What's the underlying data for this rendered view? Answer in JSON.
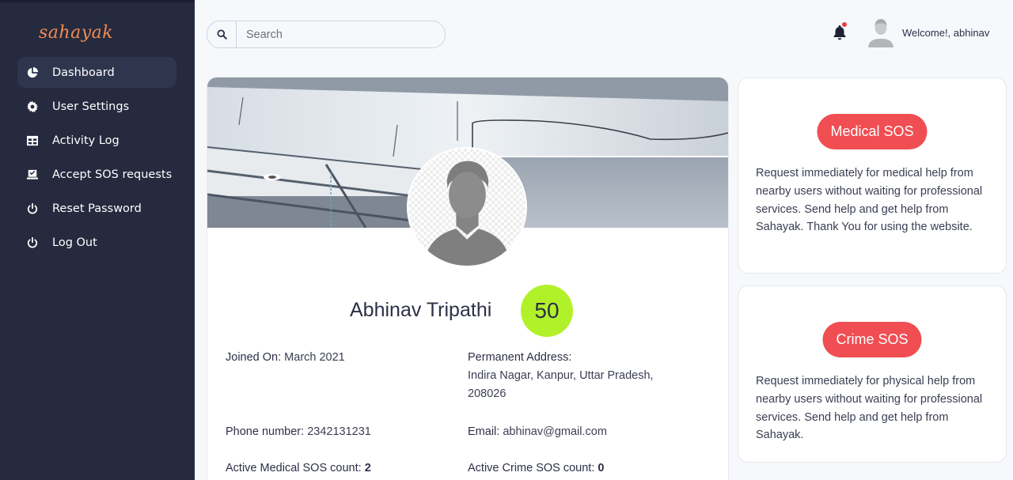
{
  "brand": "sahayak",
  "sidebar": {
    "items": [
      {
        "label": "Dashboard",
        "icon": "pie-chart-icon",
        "active": true
      },
      {
        "label": "User Settings",
        "icon": "gear-icon"
      },
      {
        "label": "Activity Log",
        "icon": "table-icon"
      },
      {
        "label": "Accept SOS requests",
        "icon": "laptop-check-icon"
      },
      {
        "label": "Reset Password",
        "icon": "power-icon"
      },
      {
        "label": "Log Out",
        "icon": "power-icon"
      }
    ]
  },
  "header": {
    "search_placeholder": "Search",
    "welcome": "Welcome!, abhinav",
    "notification_dot_color": "#ef3b45"
  },
  "profile": {
    "name": "Abhinav Tripathi",
    "score": "50",
    "joined_label": "Joined On:",
    "joined_value": "March 2021",
    "address_label": "Permanent Address:",
    "address_line1": "Indira Nagar, Kanpur, Uttar Pradesh,",
    "address_line2": "208026",
    "phone_label": "Phone number:",
    "phone_value": "2342131231",
    "email_label": "Email:",
    "email_value": "abhinav@gmail.com",
    "medical_count_label": "Active Medical SOS count:",
    "medical_count_value": "2",
    "crime_count_label": "Active Crime SOS count:",
    "crime_count_value": "0"
  },
  "medical_sos": {
    "button": "Medical SOS",
    "description": "Request immediately for medical help from nearby users without waiting for professional services. Send help and get help from Sahayak. Thank You for using the website."
  },
  "crime_sos": {
    "button": "Crime SOS",
    "description": "Request immediately for physical help from nearby users without waiting for professional services. Send help and get help from Sahayak."
  },
  "colors": {
    "sidebar_bg": "#252a3f",
    "brand": "#f08a50",
    "sos_button": "#f04e52",
    "score_badge": "#b1f12a"
  }
}
